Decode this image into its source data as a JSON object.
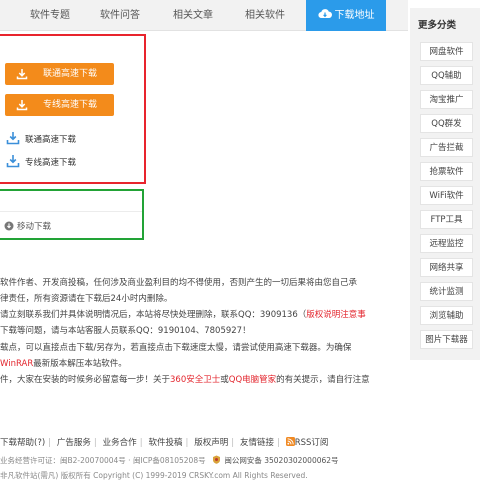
{
  "tabs": [
    {
      "label": "软件专题"
    },
    {
      "label": "软件问答"
    },
    {
      "label": "相关文章"
    },
    {
      "label": "相关软件"
    },
    {
      "label": "下载地址"
    }
  ],
  "download": {
    "btn_unicom": "联通高速下载",
    "btn_dedicated": "专线高速下载",
    "link_unicom": "联通高速下载",
    "link_dedicated": "专线高速下载",
    "mobile": "移动下载"
  },
  "notes": {
    "line1": "软件作者、开发商投稿，任何涉及商业盈利目的均不得使用，否则产生的一切后果将由您自己承",
    "line2": "律责任，所有资源请在下载后24小时内删除。",
    "line3a": "请立刻联系我们并具体说明情况后，本站将尽快处理删除，联系QQ：3909136（",
    "line3b": "版权说明注意事",
    "line4": "下载等问题，请与本站客服人员联系QQ：9190104、7805927！",
    "line5": "载点，可以直接点击下载/另存为，若直接点击下载速度太慢，请尝试使用高速下载器。为确保",
    "line6a": "",
    "line6b": "WinRAR",
    "line6c": "最新版本解压本站软件。",
    "line7a": "件，大家在安装的时候务必留意每一步！关于",
    "line7b": "360安全卫士",
    "line7c": "或",
    "line7d": "QQ电脑管家",
    "line7e": "的有关提示，请自行注意"
  },
  "footer": {
    "links": [
      "下载帮助(?)",
      "广告服务",
      "业务合作",
      "软件投稿",
      "版权声明",
      "友情链接"
    ],
    "rss": "RSS订阅",
    "license": "业务经营许可证：闽B2-20070004号 · 闽ICP备08105208号",
    "police": "闽公网安备 35020302000062号",
    "copyright": "非凡软件站(需凡) 版权所有 Copyright (C) 1999-2019 CRSKY.com All Rights Reserved."
  },
  "sidebar": {
    "title": "更多分类",
    "items": [
      "网盘软件",
      "QQ辅助",
      "淘宝推广",
      "QQ群发",
      "广告拦截",
      "抢票软件",
      "WiFi软件",
      "FTP工具",
      "远程监控",
      "网络共享",
      "统计监测",
      "浏览辅助",
      "图片下载器"
    ]
  },
  "colors": {
    "tab_active": "#2b9bea",
    "download_button": "#f38b1b",
    "highlight_red": "#e8242d",
    "highlight_green": "#22a336",
    "warning_text": "#e3262e"
  },
  "icons": {
    "tab_cloud": "cloud-download-icon",
    "button": "download-arrow-icon",
    "link": "download-tray-icon",
    "mobile": "mobile-download-icon",
    "rss": "rss-icon",
    "police": "police-badge-icon"
  }
}
